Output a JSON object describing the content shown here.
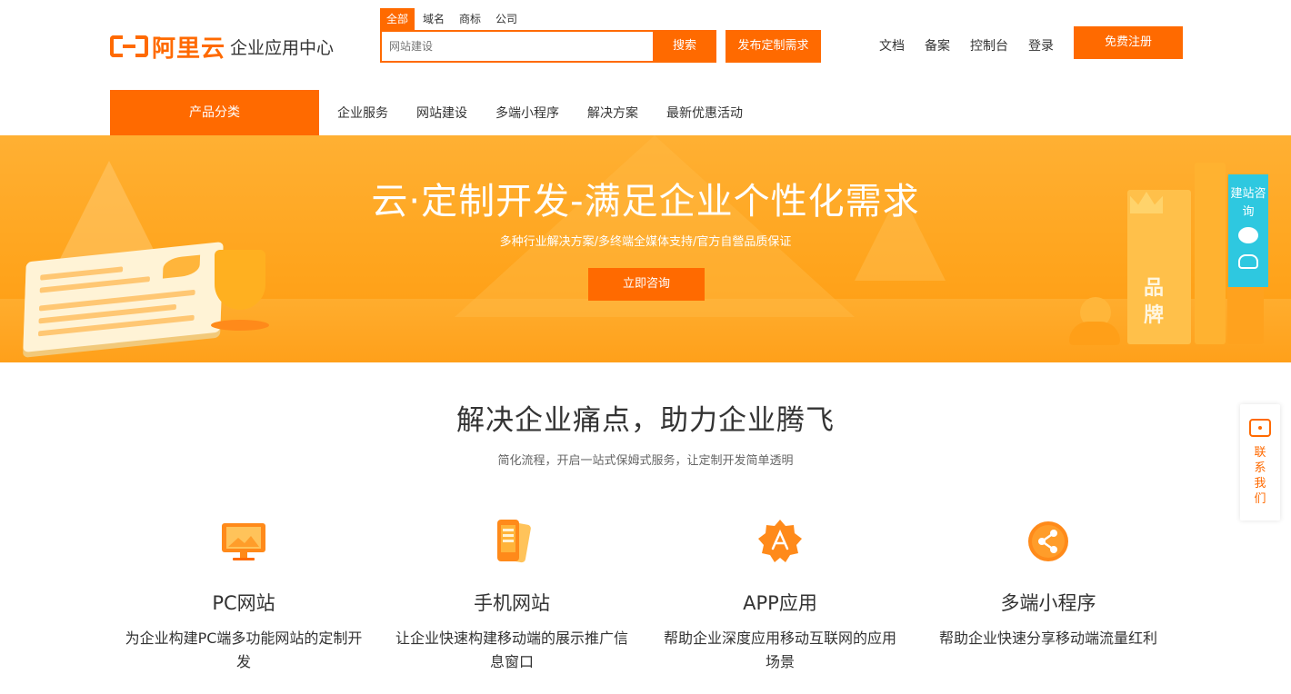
{
  "brand": {
    "logo_text": "阿里云",
    "site_name": "企业应用中心",
    "accent": "#ff6a00"
  },
  "search": {
    "tabs": [
      "全部",
      "域名",
      "商标",
      "公司"
    ],
    "active_tab": "全部",
    "placeholder": "网站建设",
    "button_label": "搜索",
    "publish_label": "发布定制需求"
  },
  "top_links": [
    "文档",
    "备案",
    "控制台",
    "登录"
  ],
  "register_label": "免费注册",
  "nav": {
    "category_label": "产品分类",
    "items": [
      "企业服务",
      "网站建设",
      "多端小程序",
      "解决方案",
      "最新优惠活动"
    ]
  },
  "banner": {
    "title": "云·定制开发-满足企业个性化需求",
    "subtitle": "多种行业解决方案/多终端全媒体支持/官方自營品质保证",
    "button_label": "立即咨询",
    "brand_chars": [
      "品",
      "牌"
    ],
    "float_label": "建站咨询"
  },
  "section": {
    "title": "解决企业痛点，助力企业腾飞",
    "subtitle": "简化流程，开启一站式保姆式服务，让定制开发简单透明",
    "features": [
      {
        "name": "PC网站",
        "desc": "为企业构建PC端多功能网站的定制开发",
        "icon": "monitor-icon"
      },
      {
        "name": "手机网站",
        "desc": "让企业快速构建移动端的展示推广信息窗口",
        "icon": "mobile-icon"
      },
      {
        "name": "APP应用",
        "desc": "帮助企业深度应用移动互联网的应用场景",
        "icon": "app-store-icon"
      },
      {
        "name": "多端小程序",
        "desc": "帮助企业快速分享移动端流量红利",
        "icon": "share-icon"
      }
    ]
  },
  "contact_label": "联系我们"
}
